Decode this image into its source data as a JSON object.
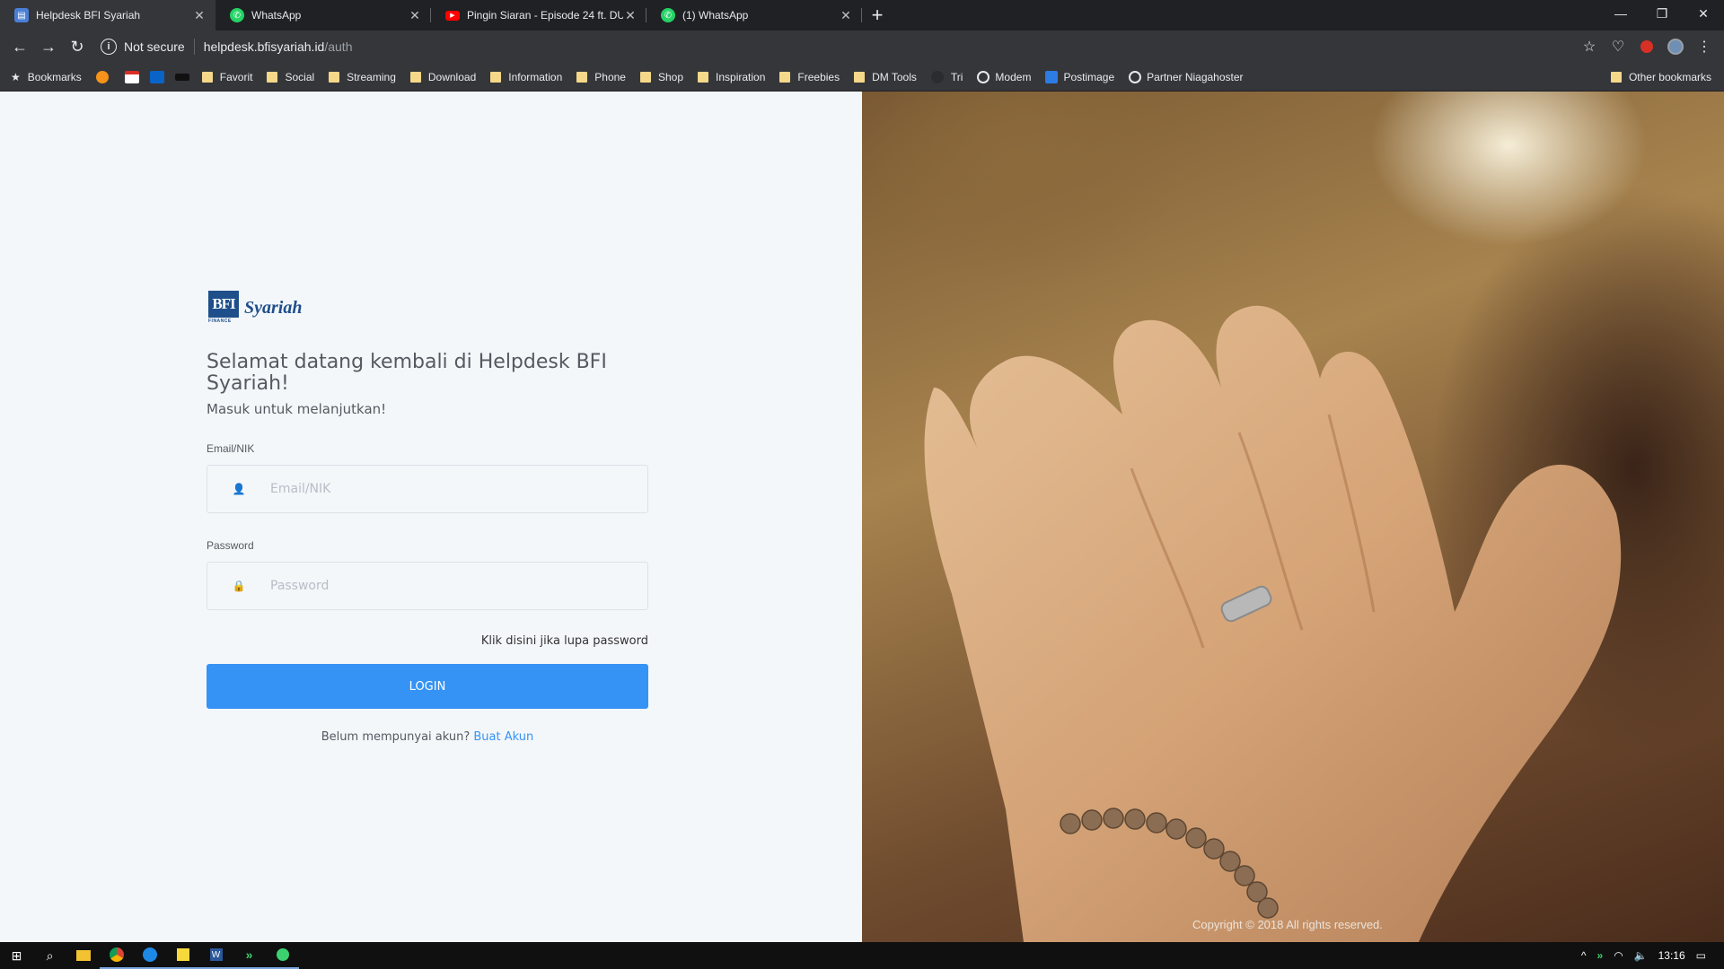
{
  "browser": {
    "tabs": [
      {
        "title": "Helpdesk BFI Syariah",
        "active": true,
        "icon": "document-icon",
        "icon_color": "#4a7fd6"
      },
      {
        "title": "WhatsApp",
        "active": false,
        "icon": "whatsapp-icon",
        "icon_color": "#25d366"
      },
      {
        "title": "Pingin Siaran - Episode 24 ft. DU",
        "active": false,
        "icon": "youtube-icon",
        "icon_color": "#ff0000"
      },
      {
        "title": "(1) WhatsApp",
        "active": false,
        "icon": "whatsapp-icon",
        "icon_color": "#25d366"
      }
    ],
    "address": {
      "security_label": "Not secure",
      "host": "helpdesk.bfisyariah.id",
      "path": "/auth"
    },
    "bookmarks": [
      {
        "label": "Bookmarks",
        "icon": "star-icon"
      },
      {
        "label": "",
        "icon": "bitcoin-icon"
      },
      {
        "label": "",
        "icon": "gmail-icon"
      },
      {
        "label": "",
        "icon": "outlook-icon"
      },
      {
        "label": "",
        "icon": "media-icon"
      },
      {
        "label": "Favorit",
        "icon": "folder-icon"
      },
      {
        "label": "Social",
        "icon": "folder-icon"
      },
      {
        "label": "Streaming",
        "icon": "folder-icon"
      },
      {
        "label": "Download",
        "icon": "folder-icon"
      },
      {
        "label": "Information",
        "icon": "folder-icon"
      },
      {
        "label": "Phone",
        "icon": "folder-icon"
      },
      {
        "label": "Shop",
        "icon": "folder-icon"
      },
      {
        "label": "Inspiration",
        "icon": "folder-icon"
      },
      {
        "label": "Freebies",
        "icon": "folder-icon"
      },
      {
        "label": "DM Tools",
        "icon": "folder-icon"
      },
      {
        "label": "Tri",
        "icon": "globe-icon"
      },
      {
        "label": "Modem",
        "icon": "globe-icon"
      },
      {
        "label": "Postimage",
        "icon": "postimage-icon"
      },
      {
        "label": "Partner Niagahoster",
        "icon": "globe-icon"
      }
    ],
    "other_bookmarks": "Other bookmarks"
  },
  "page": {
    "welcome": "Selamat datang kembali di Helpdesk BFI Syariah!",
    "subtitle": "Masuk untuk melanjutkan!",
    "email_label": "Email/NIK",
    "email_placeholder": "Email/NIK",
    "password_label": "Password",
    "password_placeholder": "Password",
    "forgot_link": "Klik disini jika lupa password",
    "login_button": "LOGIN",
    "signup_prompt": "Belum mempunyai akun?",
    "signup_link": "Buat Akun",
    "copyright": "Copyright © 2018 All rights reserved.",
    "logo": {
      "mark": "BFI",
      "mark_sub": "FINANCE",
      "wordmark": "Syariah",
      "color": "#1e4f8a"
    },
    "accent": "#3593f5"
  },
  "taskbar": {
    "time": "13:16"
  }
}
